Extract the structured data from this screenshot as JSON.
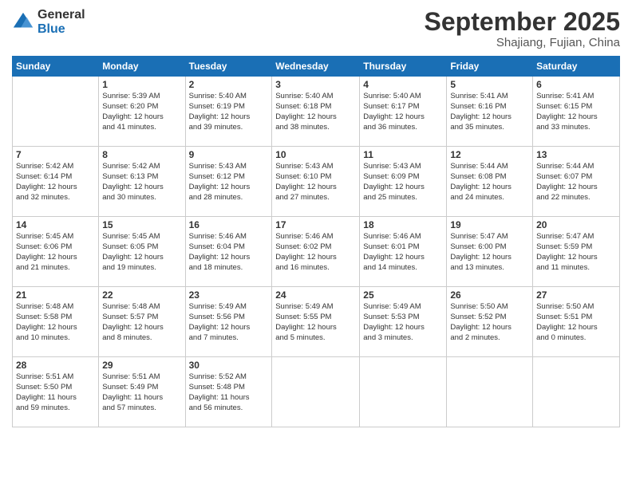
{
  "logo": {
    "line1": "General",
    "line2": "Blue"
  },
  "title": "September 2025",
  "location": "Shajiang, Fujian, China",
  "days_of_week": [
    "Sunday",
    "Monday",
    "Tuesday",
    "Wednesday",
    "Thursday",
    "Friday",
    "Saturday"
  ],
  "weeks": [
    [
      {
        "day": "",
        "info": ""
      },
      {
        "day": "1",
        "info": "Sunrise: 5:39 AM\nSunset: 6:20 PM\nDaylight: 12 hours\nand 41 minutes."
      },
      {
        "day": "2",
        "info": "Sunrise: 5:40 AM\nSunset: 6:19 PM\nDaylight: 12 hours\nand 39 minutes."
      },
      {
        "day": "3",
        "info": "Sunrise: 5:40 AM\nSunset: 6:18 PM\nDaylight: 12 hours\nand 38 minutes."
      },
      {
        "day": "4",
        "info": "Sunrise: 5:40 AM\nSunset: 6:17 PM\nDaylight: 12 hours\nand 36 minutes."
      },
      {
        "day": "5",
        "info": "Sunrise: 5:41 AM\nSunset: 6:16 PM\nDaylight: 12 hours\nand 35 minutes."
      },
      {
        "day": "6",
        "info": "Sunrise: 5:41 AM\nSunset: 6:15 PM\nDaylight: 12 hours\nand 33 minutes."
      }
    ],
    [
      {
        "day": "7",
        "info": "Sunrise: 5:42 AM\nSunset: 6:14 PM\nDaylight: 12 hours\nand 32 minutes."
      },
      {
        "day": "8",
        "info": "Sunrise: 5:42 AM\nSunset: 6:13 PM\nDaylight: 12 hours\nand 30 minutes."
      },
      {
        "day": "9",
        "info": "Sunrise: 5:43 AM\nSunset: 6:12 PM\nDaylight: 12 hours\nand 28 minutes."
      },
      {
        "day": "10",
        "info": "Sunrise: 5:43 AM\nSunset: 6:10 PM\nDaylight: 12 hours\nand 27 minutes."
      },
      {
        "day": "11",
        "info": "Sunrise: 5:43 AM\nSunset: 6:09 PM\nDaylight: 12 hours\nand 25 minutes."
      },
      {
        "day": "12",
        "info": "Sunrise: 5:44 AM\nSunset: 6:08 PM\nDaylight: 12 hours\nand 24 minutes."
      },
      {
        "day": "13",
        "info": "Sunrise: 5:44 AM\nSunset: 6:07 PM\nDaylight: 12 hours\nand 22 minutes."
      }
    ],
    [
      {
        "day": "14",
        "info": "Sunrise: 5:45 AM\nSunset: 6:06 PM\nDaylight: 12 hours\nand 21 minutes."
      },
      {
        "day": "15",
        "info": "Sunrise: 5:45 AM\nSunset: 6:05 PM\nDaylight: 12 hours\nand 19 minutes."
      },
      {
        "day": "16",
        "info": "Sunrise: 5:46 AM\nSunset: 6:04 PM\nDaylight: 12 hours\nand 18 minutes."
      },
      {
        "day": "17",
        "info": "Sunrise: 5:46 AM\nSunset: 6:02 PM\nDaylight: 12 hours\nand 16 minutes."
      },
      {
        "day": "18",
        "info": "Sunrise: 5:46 AM\nSunset: 6:01 PM\nDaylight: 12 hours\nand 14 minutes."
      },
      {
        "day": "19",
        "info": "Sunrise: 5:47 AM\nSunset: 6:00 PM\nDaylight: 12 hours\nand 13 minutes."
      },
      {
        "day": "20",
        "info": "Sunrise: 5:47 AM\nSunset: 5:59 PM\nDaylight: 12 hours\nand 11 minutes."
      }
    ],
    [
      {
        "day": "21",
        "info": "Sunrise: 5:48 AM\nSunset: 5:58 PM\nDaylight: 12 hours\nand 10 minutes."
      },
      {
        "day": "22",
        "info": "Sunrise: 5:48 AM\nSunset: 5:57 PM\nDaylight: 12 hours\nand 8 minutes."
      },
      {
        "day": "23",
        "info": "Sunrise: 5:49 AM\nSunset: 5:56 PM\nDaylight: 12 hours\nand 7 minutes."
      },
      {
        "day": "24",
        "info": "Sunrise: 5:49 AM\nSunset: 5:55 PM\nDaylight: 12 hours\nand 5 minutes."
      },
      {
        "day": "25",
        "info": "Sunrise: 5:49 AM\nSunset: 5:53 PM\nDaylight: 12 hours\nand 3 minutes."
      },
      {
        "day": "26",
        "info": "Sunrise: 5:50 AM\nSunset: 5:52 PM\nDaylight: 12 hours\nand 2 minutes."
      },
      {
        "day": "27",
        "info": "Sunrise: 5:50 AM\nSunset: 5:51 PM\nDaylight: 12 hours\nand 0 minutes."
      }
    ],
    [
      {
        "day": "28",
        "info": "Sunrise: 5:51 AM\nSunset: 5:50 PM\nDaylight: 11 hours\nand 59 minutes."
      },
      {
        "day": "29",
        "info": "Sunrise: 5:51 AM\nSunset: 5:49 PM\nDaylight: 11 hours\nand 57 minutes."
      },
      {
        "day": "30",
        "info": "Sunrise: 5:52 AM\nSunset: 5:48 PM\nDaylight: 11 hours\nand 56 minutes."
      },
      {
        "day": "",
        "info": ""
      },
      {
        "day": "",
        "info": ""
      },
      {
        "day": "",
        "info": ""
      },
      {
        "day": "",
        "info": ""
      }
    ]
  ]
}
